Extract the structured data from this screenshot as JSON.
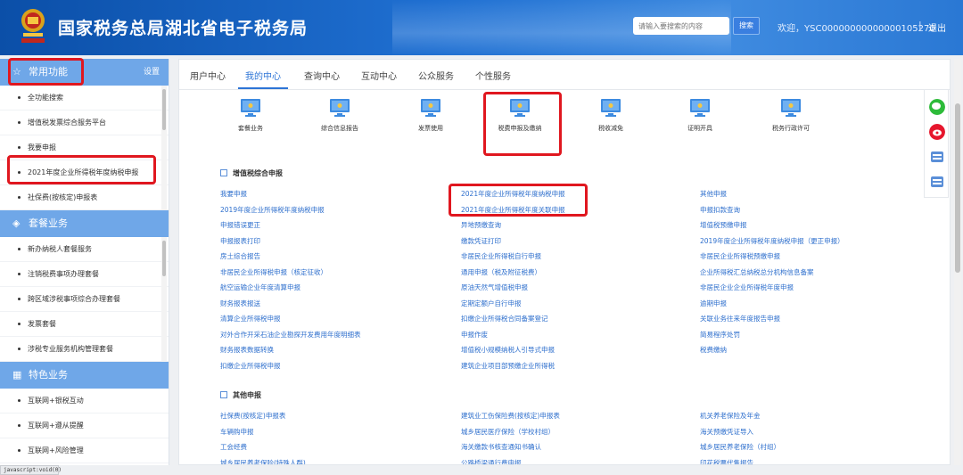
{
  "header": {
    "title": "国家税务总局湖北省电子税务局",
    "search_placeholder": "请输入要搜索的内容",
    "search_button": "搜索",
    "welcome": "欢迎，YSC00000000000000105270",
    "separator": "|",
    "logout": "退出"
  },
  "sidebar": {
    "sections": [
      {
        "title": "常用功能",
        "settings": "设置",
        "icon": "star-icon",
        "items": [
          "全功能搜索",
          "增值税发票综合服务平台",
          "我要申报",
          "2021年度企业所得税年度纳税申报",
          "社保费(按核定)申报表"
        ]
      },
      {
        "title": "套餐业务",
        "icon": "package-icon",
        "items": [
          "新办纳税人套餐服务",
          "注销税费事项办理套餐",
          "跨区域涉税事项综合办理套餐",
          "发票套餐",
          "涉税专业服务机构管理套餐"
        ]
      },
      {
        "title": "特色业务",
        "icon": "grid-icon",
        "items": [
          "互联网+银税互动",
          "互联网+遵从提醒",
          "互联网+风险管理"
        ]
      }
    ]
  },
  "tabs": [
    "用户中心",
    "我的中心",
    "查询中心",
    "互动中心",
    "公众服务",
    "个性服务"
  ],
  "active_tab": 1,
  "functions": [
    "套餐业务",
    "综合信息报告",
    "发票使用",
    "税费申报及缴纳",
    "税收减免",
    "证明开具",
    "税务行政许可"
  ],
  "section1": {
    "title": "增值税综合申报",
    "links": [
      [
        "我要申报",
        "2021年度企业所得税年度纳税申报",
        "其他申报"
      ],
      [
        "2019年度企业所得税年度纳税申报",
        "2021年度企业所得税年度关联申报",
        "申报扣款查询"
      ],
      [
        "申报错误更正",
        "异地预缴查询",
        "增值税预缴申报"
      ],
      [
        "申报报表打印",
        "缴款凭证打印",
        "2019年度企业所得税年度纳税申报（更正申报）"
      ],
      [
        "房土综合报告",
        "非居民企业所得税自行申报",
        "非居民企业所得税预缴申报"
      ],
      [
        "非居民企业所得税申报（核定征收）",
        "通用申报（税及附征税费）",
        "企业所得税汇总纳税总分机构信息备案"
      ],
      [
        "航空运输企业年度清算申报",
        "原油天然气增值税申报",
        "非居民企业企业所得税年度申报"
      ],
      [
        "财务报表报送",
        "定期定额户自行申报",
        "逾期申报"
      ],
      [
        "清算企业所得税申报",
        "扣缴企业所得税合同备案登记",
        "关联业务往来年度报告申报"
      ],
      [
        "对外合作开采石油企业勘探开发费用年度明细表",
        "申报作废",
        "简易程序处罚"
      ],
      [
        "财务报表数据转换",
        "增值税小规模纳税人引导式申报",
        "税费缴纳"
      ],
      [
        "扣缴企业所得税申报",
        "建筑企业项目部预缴企业所得税",
        ""
      ]
    ]
  },
  "section2": {
    "title": "其他申报",
    "links": [
      [
        "社保费(按核定)申报表",
        "建筑业工伤保险费(按核定)申报表",
        "机关养老保险及年金"
      ],
      [
        "车辆购申报",
        "城乡居民医疗保险（学校村组）",
        "海关预缴凭证导入"
      ],
      [
        "工会经费",
        "海关缴款书核查通知书确认",
        "城乡居民养老保险（村组）"
      ],
      [
        "城乡居民养老保险(特殊人群)",
        "公路桥梁通行费申报",
        "印花税票代售报告"
      ]
    ]
  },
  "status_bar": "javascript:void(0)"
}
